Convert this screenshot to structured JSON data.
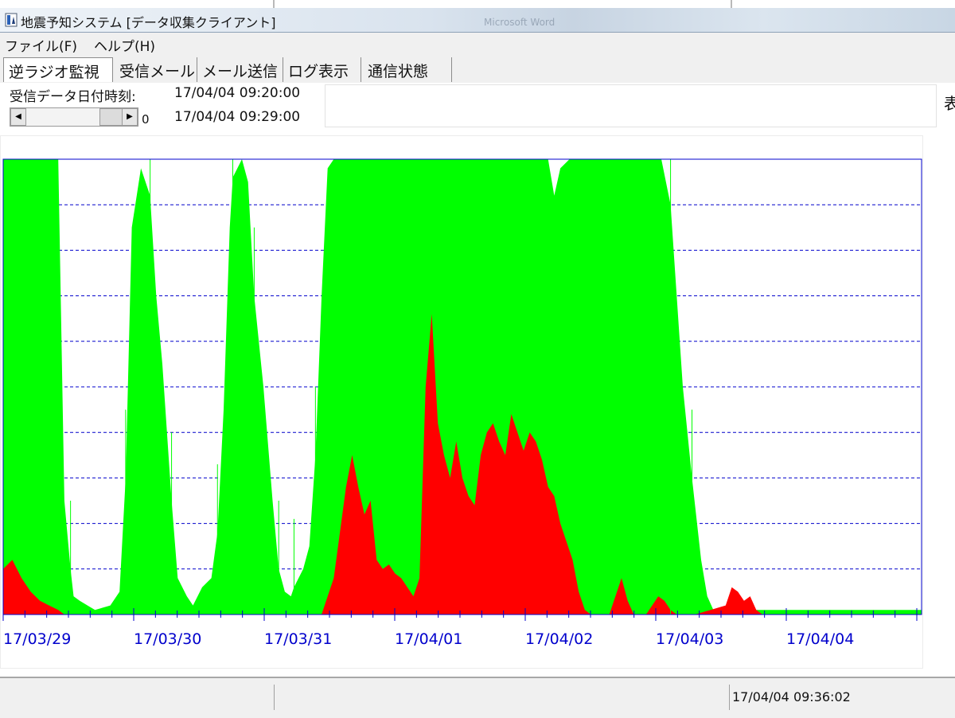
{
  "window": {
    "title": "地震予知システム [データ収集クライアント]",
    "ghost_title": "Microsoft Word"
  },
  "menu": {
    "items": [
      "ファイル(F)",
      "ヘルプ(H)"
    ]
  },
  "tabs": [
    {
      "label": "逆ラジオ監視"
    },
    {
      "label": "受信メール"
    },
    {
      "label": "メール送信"
    },
    {
      "label": "ログ表示"
    },
    {
      "label": "通信状態"
    }
  ],
  "panel": {
    "received_label": "受信データ日付時刻:",
    "time_from": "17/04/04 09:20:00",
    "time_to": "17/04/04 09:29:00",
    "scroll_value": "0",
    "right_edge_text": "表"
  },
  "chart_data": {
    "type": "area",
    "title": "",
    "xlabel": "",
    "ylabel": "",
    "x_tick_labels": [
      "17/03/29",
      "17/03/30",
      "17/03/31",
      "17/04/01",
      "17/04/02",
      "17/04/03",
      "17/04/04"
    ],
    "grid": "horizontal dashed",
    "colors": {
      "green": "#00ff00",
      "red": "#ff0000",
      "axis": "#0000cc"
    },
    "ylim": [
      0,
      100
    ],
    "series": [
      {
        "color": "#00ff00",
        "points": [
          [
            0,
            100
          ],
          [
            5,
            100
          ],
          [
            10,
            100
          ],
          [
            15,
            100
          ],
          [
            18,
            100
          ],
          [
            20,
            25
          ],
          [
            22,
            10
          ],
          [
            23,
            4
          ],
          [
            25,
            3
          ],
          [
            30,
            1
          ],
          [
            35,
            2
          ],
          [
            38,
            5
          ],
          [
            40,
            30
          ],
          [
            42,
            85
          ],
          [
            45,
            98
          ],
          [
            48,
            92
          ],
          [
            50,
            70
          ],
          [
            52,
            55
          ],
          [
            55,
            25
          ],
          [
            57,
            8
          ],
          [
            60,
            4
          ],
          [
            62,
            2
          ],
          [
            65,
            6
          ],
          [
            68,
            8
          ],
          [
            70,
            18
          ],
          [
            72,
            45
          ],
          [
            74,
            85
          ],
          [
            75,
            96
          ],
          [
            78,
            100
          ],
          [
            80,
            95
          ],
          [
            82,
            70
          ],
          [
            85,
            50
          ],
          [
            88,
            25
          ],
          [
            90,
            10
          ],
          [
            92,
            5
          ],
          [
            94,
            4
          ],
          [
            95,
            6
          ],
          [
            98,
            10
          ],
          [
            100,
            15
          ],
          [
            102,
            35
          ],
          [
            104,
            70
          ],
          [
            106,
            98
          ],
          [
            108,
            100
          ],
          [
            110,
            100
          ],
          [
            115,
            100
          ],
          [
            120,
            100
          ],
          [
            125,
            100
          ],
          [
            130,
            100
          ],
          [
            135,
            100
          ],
          [
            140,
            100
          ],
          [
            145,
            100
          ],
          [
            150,
            100
          ],
          [
            155,
            100
          ],
          [
            160,
            100
          ],
          [
            165,
            100
          ],
          [
            170,
            100
          ],
          [
            175,
            100
          ],
          [
            178,
            100
          ],
          [
            180,
            92
          ],
          [
            182,
            98
          ],
          [
            185,
            100
          ],
          [
            188,
            100
          ],
          [
            190,
            100
          ],
          [
            192,
            100
          ],
          [
            195,
            100
          ],
          [
            200,
            100
          ],
          [
            202,
            100
          ],
          [
            205,
            100
          ],
          [
            208,
            100
          ],
          [
            210,
            100
          ],
          [
            212,
            100
          ],
          [
            215,
            100
          ],
          [
            218,
            90
          ],
          [
            220,
            70
          ],
          [
            222,
            50
          ],
          [
            225,
            30
          ],
          [
            228,
            12
          ],
          [
            230,
            4
          ],
          [
            232,
            1
          ],
          [
            235,
            1
          ],
          [
            240,
            1
          ],
          [
            245,
            1
          ],
          [
            250,
            1
          ],
          [
            255,
            1
          ],
          [
            260,
            1
          ],
          [
            265,
            1
          ],
          [
            270,
            1
          ],
          [
            275,
            1
          ],
          [
            280,
            1
          ],
          [
            285,
            1
          ],
          [
            290,
            1
          ],
          [
            295,
            1
          ],
          [
            300,
            1
          ]
        ]
      },
      {
        "color": "#ff0000",
        "points": [
          [
            0,
            10
          ],
          [
            3,
            12
          ],
          [
            6,
            8
          ],
          [
            9,
            5
          ],
          [
            12,
            3
          ],
          [
            15,
            2
          ],
          [
            18,
            1
          ],
          [
            20,
            0
          ],
          [
            30,
            0
          ],
          [
            42,
            0
          ],
          [
            45,
            0
          ],
          [
            60,
            0
          ],
          [
            75,
            0
          ],
          [
            90,
            0
          ],
          [
            104,
            0
          ],
          [
            106,
            4
          ],
          [
            108,
            8
          ],
          [
            110,
            18
          ],
          [
            112,
            28
          ],
          [
            114,
            35
          ],
          [
            116,
            28
          ],
          [
            118,
            22
          ],
          [
            120,
            25
          ],
          [
            122,
            12
          ],
          [
            124,
            10
          ],
          [
            126,
            11
          ],
          [
            128,
            9
          ],
          [
            130,
            8
          ],
          [
            132,
            6
          ],
          [
            134,
            4
          ],
          [
            136,
            8
          ],
          [
            138,
            50
          ],
          [
            140,
            66
          ],
          [
            142,
            42
          ],
          [
            144,
            35
          ],
          [
            146,
            30
          ],
          [
            148,
            38
          ],
          [
            150,
            30
          ],
          [
            152,
            26
          ],
          [
            154,
            24
          ],
          [
            156,
            35
          ],
          [
            158,
            40
          ],
          [
            160,
            42
          ],
          [
            162,
            38
          ],
          [
            164,
            35
          ],
          [
            166,
            44
          ],
          [
            168,
            40
          ],
          [
            170,
            36
          ],
          [
            172,
            40
          ],
          [
            174,
            38
          ],
          [
            176,
            34
          ],
          [
            178,
            28
          ],
          [
            180,
            26
          ],
          [
            182,
            20
          ],
          [
            184,
            16
          ],
          [
            186,
            12
          ],
          [
            188,
            5
          ],
          [
            190,
            1
          ],
          [
            192,
            0
          ],
          [
            198,
            0
          ],
          [
            200,
            4
          ],
          [
            202,
            8
          ],
          [
            204,
            3
          ],
          [
            206,
            0
          ],
          [
            210,
            0
          ],
          [
            214,
            4
          ],
          [
            216,
            3
          ],
          [
            218,
            1
          ],
          [
            220,
            0
          ],
          [
            226,
            0
          ],
          [
            236,
            2
          ],
          [
            238,
            6
          ],
          [
            240,
            5
          ],
          [
            242,
            3
          ],
          [
            244,
            4
          ],
          [
            246,
            1
          ],
          [
            248,
            0
          ],
          [
            260,
            0
          ],
          [
            270,
            0
          ],
          [
            280,
            0
          ],
          [
            290,
            0
          ],
          [
            300,
            0
          ]
        ]
      }
    ]
  },
  "status": {
    "time": "17/04/04 09:36:02"
  }
}
